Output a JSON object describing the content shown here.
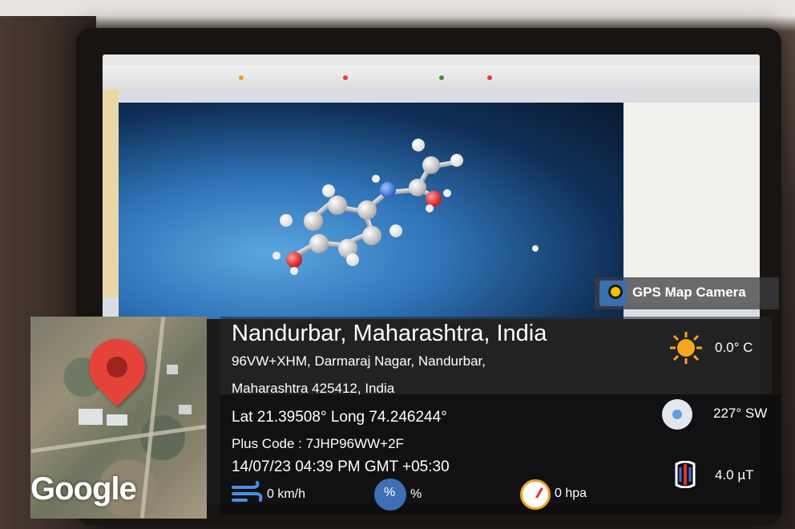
{
  "badge": {
    "label": "GPS Map Camera",
    "icon": "gps-map-camera-logo-icon"
  },
  "location": {
    "title": "Nandurbar, Maharashtra, India",
    "address_line1": "96VW+XHM, Darmaraj Nagar, Nandurbar,",
    "address_line2": "Maharashtra 425412, India",
    "lat_long": "Lat 21.39508° Long 74.246244°",
    "plus_code": "Plus Code : 7JHP96WW+2F",
    "datetime": "14/07/23 04:39 PM GMT +05:30"
  },
  "map": {
    "logo_text": "Google",
    "pin_icon": "map-pin-icon"
  },
  "weather": {
    "temperature": "0.0° C",
    "wind_direction": "227° SW",
    "magnetic_field": "4.0 µT",
    "wind_speed": "0 km/h",
    "humidity": "%",
    "pressure": "0 hpa"
  },
  "colors": {
    "pin": "#e4433a",
    "sun": "#f5a623",
    "overlay": "#1a1a1e"
  }
}
